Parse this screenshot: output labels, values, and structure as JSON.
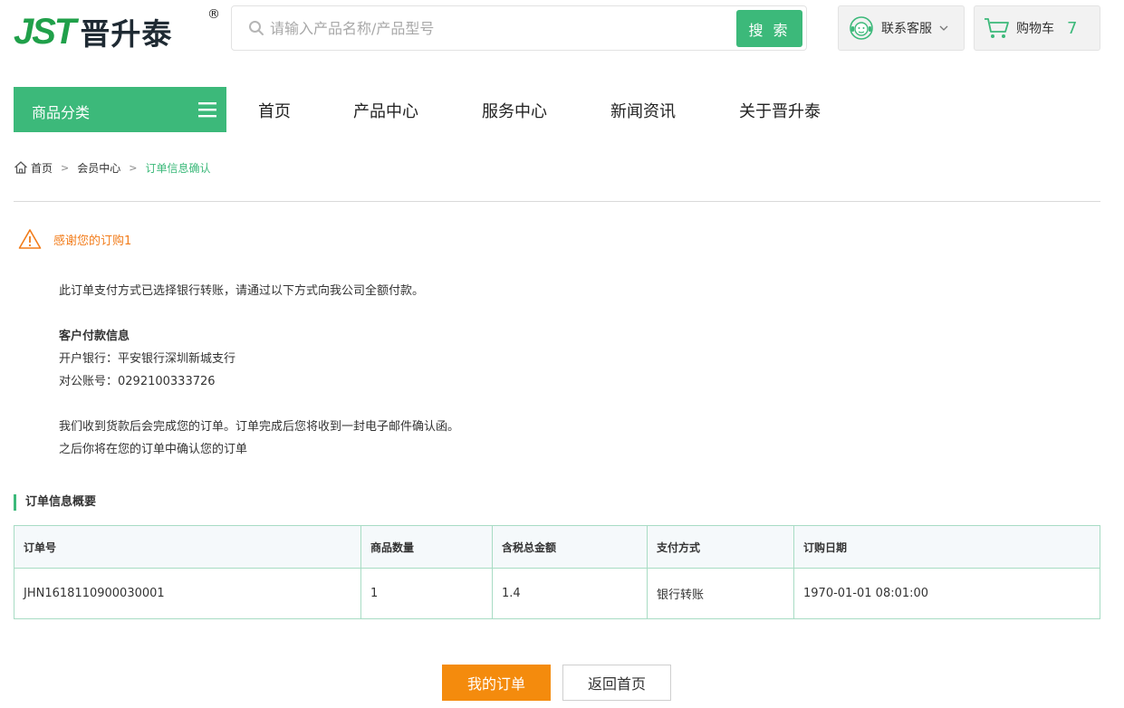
{
  "header": {
    "logo_mark": "JST",
    "logo_text": "晋升泰",
    "logo_reg": "®",
    "search_placeholder": "请输入产品名称/产品型号",
    "search_button": "搜 索",
    "service_label": "联系客服",
    "cart_label": "购物车",
    "cart_count": "7"
  },
  "nav": {
    "category_label": "商品分类",
    "items": [
      "首页",
      "产品中心",
      "服务中心",
      "新闻资讯",
      "关于晋升泰"
    ]
  },
  "breadcrumb": {
    "home": "首页",
    "member": "会员中心",
    "current": "订单信息确认",
    "separator": ">"
  },
  "notice": {
    "thanks": "感谢您的订购1",
    "payment_method_line": "此订单支付方式已选择银行转账，请通过以下方式向我公司全额付款。",
    "payment_info_title": "客户付款信息",
    "bank_line": "开户银行：平安银行深圳新城支行",
    "account_line": "对公账号：0292100333726",
    "confirm_line1": "我们收到货款后会完成您的订单。订单完成后您将收到一封电子邮件确认函。",
    "confirm_line2": "之后你将在您的订单中确认您的订单"
  },
  "order_summary": {
    "title": "订单信息概要",
    "columns": [
      "订单号",
      "商品数量",
      "含税总金额",
      "支付方式",
      "订购日期"
    ],
    "row": [
      "JHN1618110900030001",
      "1",
      "1.4",
      "银行转账",
      "1970-01-01 08:01:00"
    ]
  },
  "buttons": {
    "my_orders": "我的订单",
    "back_home": "返回首页"
  },
  "colors": {
    "brand_green": "#3cb97a",
    "accent_orange": "#f48b0d",
    "notice_orange": "#f27c1a"
  }
}
